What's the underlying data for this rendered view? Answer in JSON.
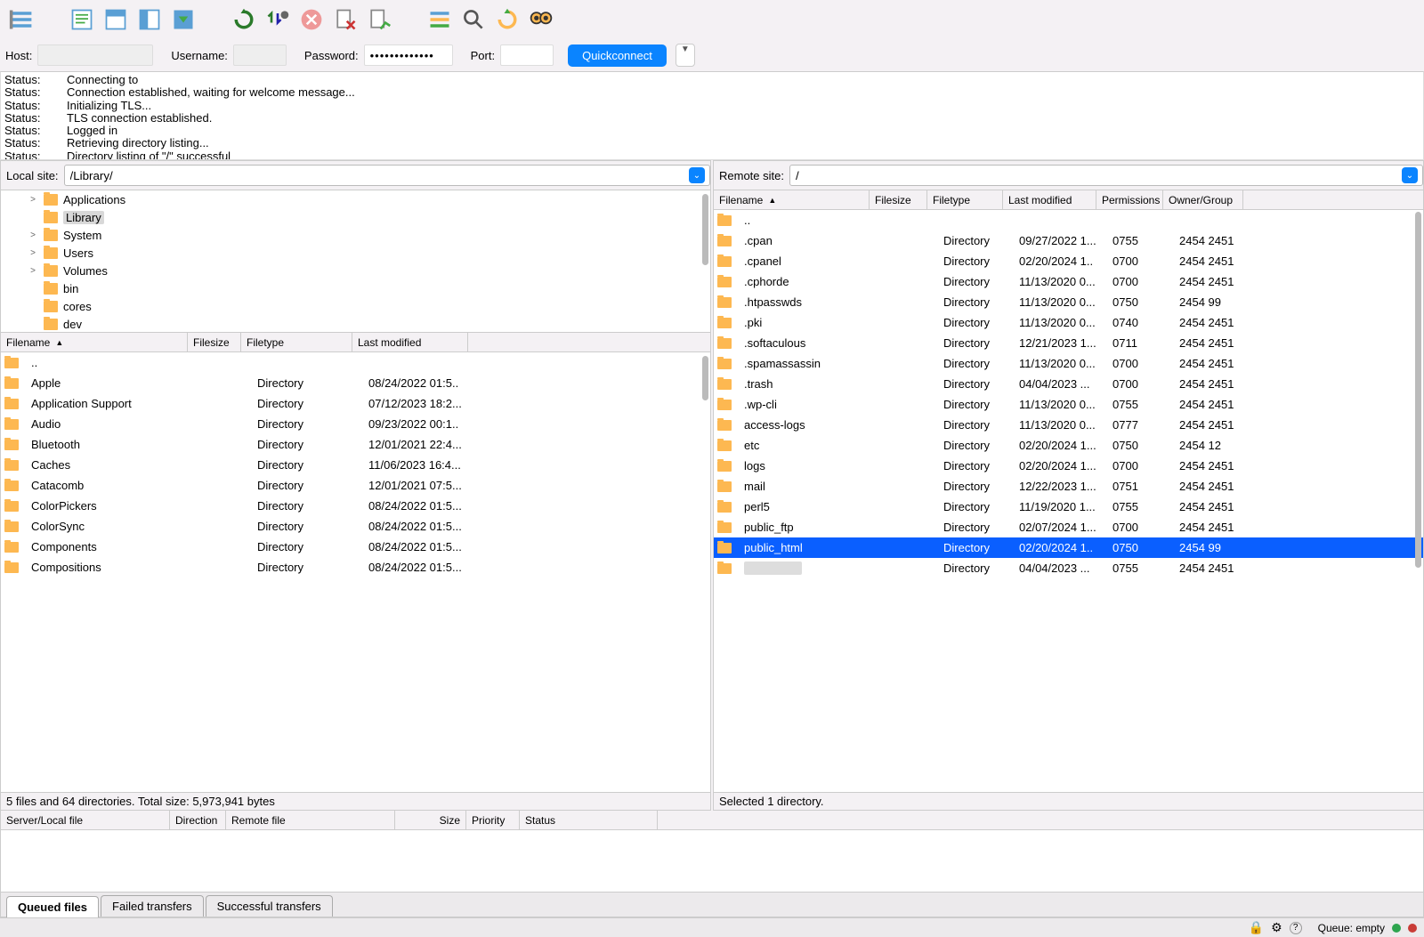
{
  "conn": {
    "host_label": "Host:",
    "user_label": "Username:",
    "pass_label": "Password:",
    "port_label": "Port:",
    "host": "",
    "user": "",
    "pass": "•••••••••••••",
    "port": "",
    "quick": "Quickconnect"
  },
  "log": [
    {
      "l": "Status:",
      "m": "Connecting to"
    },
    {
      "l": "Status:",
      "m": "Connection established, waiting for welcome message..."
    },
    {
      "l": "Status:",
      "m": "Initializing TLS..."
    },
    {
      "l": "Status:",
      "m": "TLS connection established."
    },
    {
      "l": "Status:",
      "m": "Logged in"
    },
    {
      "l": "Status:",
      "m": "Retrieving directory listing..."
    },
    {
      "l": "Status:",
      "m": "Directory listing of \"/\" successful"
    }
  ],
  "local": {
    "label": "Local site:",
    "path": "/Library/",
    "tree": [
      {
        "d": ">",
        "n": "Applications"
      },
      {
        "d": "",
        "n": "Library",
        "sel": true
      },
      {
        "d": ">",
        "n": "System"
      },
      {
        "d": ">",
        "n": "Users"
      },
      {
        "d": ">",
        "n": "Volumes"
      },
      {
        "d": "",
        "n": "bin"
      },
      {
        "d": "",
        "n": "cores"
      },
      {
        "d": "",
        "n": "dev"
      }
    ],
    "cols": {
      "name": "Filename",
      "size": "Filesize",
      "type": "Filetype",
      "mod": "Last modified"
    },
    "files": [
      {
        "n": "..",
        "t": "",
        "m": ""
      },
      {
        "n": "Apple",
        "t": "Directory",
        "m": "08/24/2022 01:5.."
      },
      {
        "n": "Application Support",
        "t": "Directory",
        "m": "07/12/2023 18:2..."
      },
      {
        "n": "Audio",
        "t": "Directory",
        "m": "09/23/2022 00:1.."
      },
      {
        "n": "Bluetooth",
        "t": "Directory",
        "m": "12/01/2021 22:4..."
      },
      {
        "n": "Caches",
        "t": "Directory",
        "m": "11/06/2023 16:4..."
      },
      {
        "n": "Catacomb",
        "t": "Directory",
        "m": "12/01/2021 07:5..."
      },
      {
        "n": "ColorPickers",
        "t": "Directory",
        "m": "08/24/2022 01:5..."
      },
      {
        "n": "ColorSync",
        "t": "Directory",
        "m": "08/24/2022 01:5..."
      },
      {
        "n": "Components",
        "t": "Directory",
        "m": "08/24/2022 01:5..."
      },
      {
        "n": "Compositions",
        "t": "Directory",
        "m": "08/24/2022 01:5..."
      }
    ],
    "status": "5 files and 64 directories. Total size: 5,973,941 bytes"
  },
  "remote": {
    "label": "Remote site:",
    "path": "/",
    "cols": {
      "name": "Filename",
      "size": "Filesize",
      "type": "Filetype",
      "mod": "Last modified",
      "perm": "Permissions",
      "own": "Owner/Group"
    },
    "files": [
      {
        "n": "..",
        "t": "",
        "m": "",
        "p": "",
        "o": ""
      },
      {
        "n": ".cpan",
        "t": "Directory",
        "m": "09/27/2022 1...",
        "p": "0755",
        "o": "2454 2451"
      },
      {
        "n": ".cpanel",
        "t": "Directory",
        "m": "02/20/2024 1..",
        "p": "0700",
        "o": "2454 2451"
      },
      {
        "n": ".cphorde",
        "t": "Directory",
        "m": "11/13/2020 0...",
        "p": "0700",
        "o": "2454 2451"
      },
      {
        "n": ".htpasswds",
        "t": "Directory",
        "m": "11/13/2020 0...",
        "p": "0750",
        "o": "2454 99"
      },
      {
        "n": ".pki",
        "t": "Directory",
        "m": "11/13/2020 0...",
        "p": "0740",
        "o": "2454 2451"
      },
      {
        "n": ".softaculous",
        "t": "Directory",
        "m": "12/21/2023 1...",
        "p": "0711",
        "o": "2454 2451"
      },
      {
        "n": ".spamassassin",
        "t": "Directory",
        "m": "11/13/2020 0...",
        "p": "0700",
        "o": "2454 2451"
      },
      {
        "n": ".trash",
        "t": "Directory",
        "m": "04/04/2023 ...",
        "p": "0700",
        "o": "2454 2451"
      },
      {
        "n": ".wp-cli",
        "t": "Directory",
        "m": "11/13/2020 0...",
        "p": "0755",
        "o": "2454 2451"
      },
      {
        "n": "access-logs",
        "t": "Directory",
        "m": "11/13/2020 0...",
        "p": "0777",
        "o": "2454 2451"
      },
      {
        "n": "etc",
        "t": "Directory",
        "m": "02/20/2024 1...",
        "p": "0750",
        "o": "2454 12"
      },
      {
        "n": "logs",
        "t": "Directory",
        "m": "02/20/2024 1...",
        "p": "0700",
        "o": "2454 2451"
      },
      {
        "n": "mail",
        "t": "Directory",
        "m": "12/22/2023 1...",
        "p": "0751",
        "o": "2454 2451"
      },
      {
        "n": "perl5",
        "t": "Directory",
        "m": "11/19/2020 1...",
        "p": "0755",
        "o": "2454 2451"
      },
      {
        "n": "public_ftp",
        "t": "Directory",
        "m": "02/07/2024 1...",
        "p": "0700",
        "o": "2454 2451"
      },
      {
        "n": "public_html",
        "t": "Directory",
        "m": "02/20/2024 1..",
        "p": "0750",
        "o": "2454 99",
        "sel": true
      },
      {
        "n": "",
        "t": "Directory",
        "m": "04/04/2023 ...",
        "p": "0755",
        "o": "2454 2451",
        "blur": true
      }
    ],
    "status": "Selected 1 directory."
  },
  "trans": {
    "cols": {
      "slf": "Server/Local file",
      "dir": "Direction",
      "rf": "Remote file",
      "sz": "Size",
      "pri": "Priority",
      "st": "Status"
    }
  },
  "tabs": {
    "q": "Queued files",
    "f": "Failed transfers",
    "s": "Successful transfers"
  },
  "bottom": {
    "queue": "Queue: empty"
  }
}
